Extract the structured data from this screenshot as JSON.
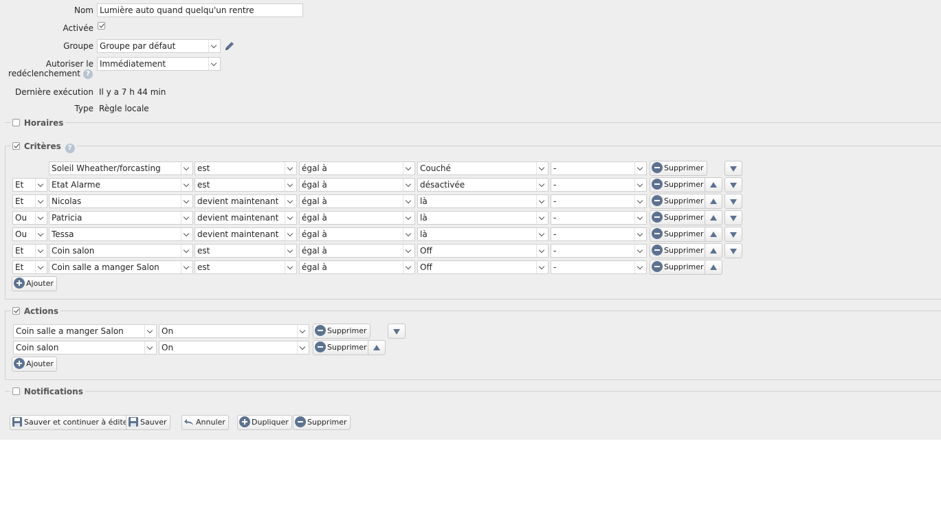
{
  "form": {
    "name_label": "Nom",
    "name_value": "Lumière auto quand quelqu'un rentre",
    "enabled_label": "Activée",
    "group_label": "Groupe",
    "group_value": "Groupe par défaut",
    "retrigger_label_line1": "Autoriser le",
    "retrigger_label_line2": "redéclenchement",
    "retrigger_value": "Immédiatement",
    "last_run_label": "Dernière exécution",
    "last_run_value": "Il y a 7 h 44 min",
    "type_label": "Type",
    "type_value": "Règle locale"
  },
  "sections": {
    "schedules": "Horaires",
    "criteria": "Critères",
    "actions": "Actions",
    "notifications": "Notifications"
  },
  "criteria": [
    {
      "logic": "",
      "device": "Soleil Wheather/forcasting",
      "op": "est",
      "cmp": "égal à",
      "value": "Couché",
      "extra": "-",
      "up": false,
      "down": true
    },
    {
      "logic": "Et",
      "device": "Etat Alarme",
      "op": "est",
      "cmp": "égal à",
      "value": "désactivée",
      "extra": "-",
      "up": true,
      "down": true
    },
    {
      "logic": "Et",
      "device": "Nicolas",
      "op": "devient maintenant",
      "cmp": "égal à",
      "value": "là",
      "extra": "-",
      "up": true,
      "down": true
    },
    {
      "logic": "Ou",
      "device": "Patricia",
      "op": "devient maintenant",
      "cmp": "égal à",
      "value": "là",
      "extra": "-",
      "up": true,
      "down": true
    },
    {
      "logic": "Ou",
      "device": "Tessa",
      "op": "devient maintenant",
      "cmp": "égal à",
      "value": "là",
      "extra": "-",
      "up": true,
      "down": true
    },
    {
      "logic": "Et",
      "device": "Coin salon",
      "op": "est",
      "cmp": "égal à",
      "value": "Off",
      "extra": "-",
      "up": true,
      "down": true
    },
    {
      "logic": "Et",
      "device": "Coin salle a manger Salon",
      "op": "est",
      "cmp": "égal à",
      "value": "Off",
      "extra": "-",
      "up": true,
      "down": false
    }
  ],
  "actions": [
    {
      "device": "Coin salle a manger Salon",
      "value": "On",
      "up": false,
      "down": true
    },
    {
      "device": "Coin salon",
      "value": "On",
      "up": true,
      "down": false
    }
  ],
  "labels": {
    "delete": "Supprimer",
    "add": "Ajouter"
  },
  "footer": {
    "save_continue": "Sauver et continuer à éditer",
    "save": "Sauver",
    "cancel": "Annuler",
    "duplicate": "Dupliquer",
    "delete": "Supprimer"
  },
  "colors": {
    "accent": "#5d7290",
    "background": "#eeeeee"
  }
}
